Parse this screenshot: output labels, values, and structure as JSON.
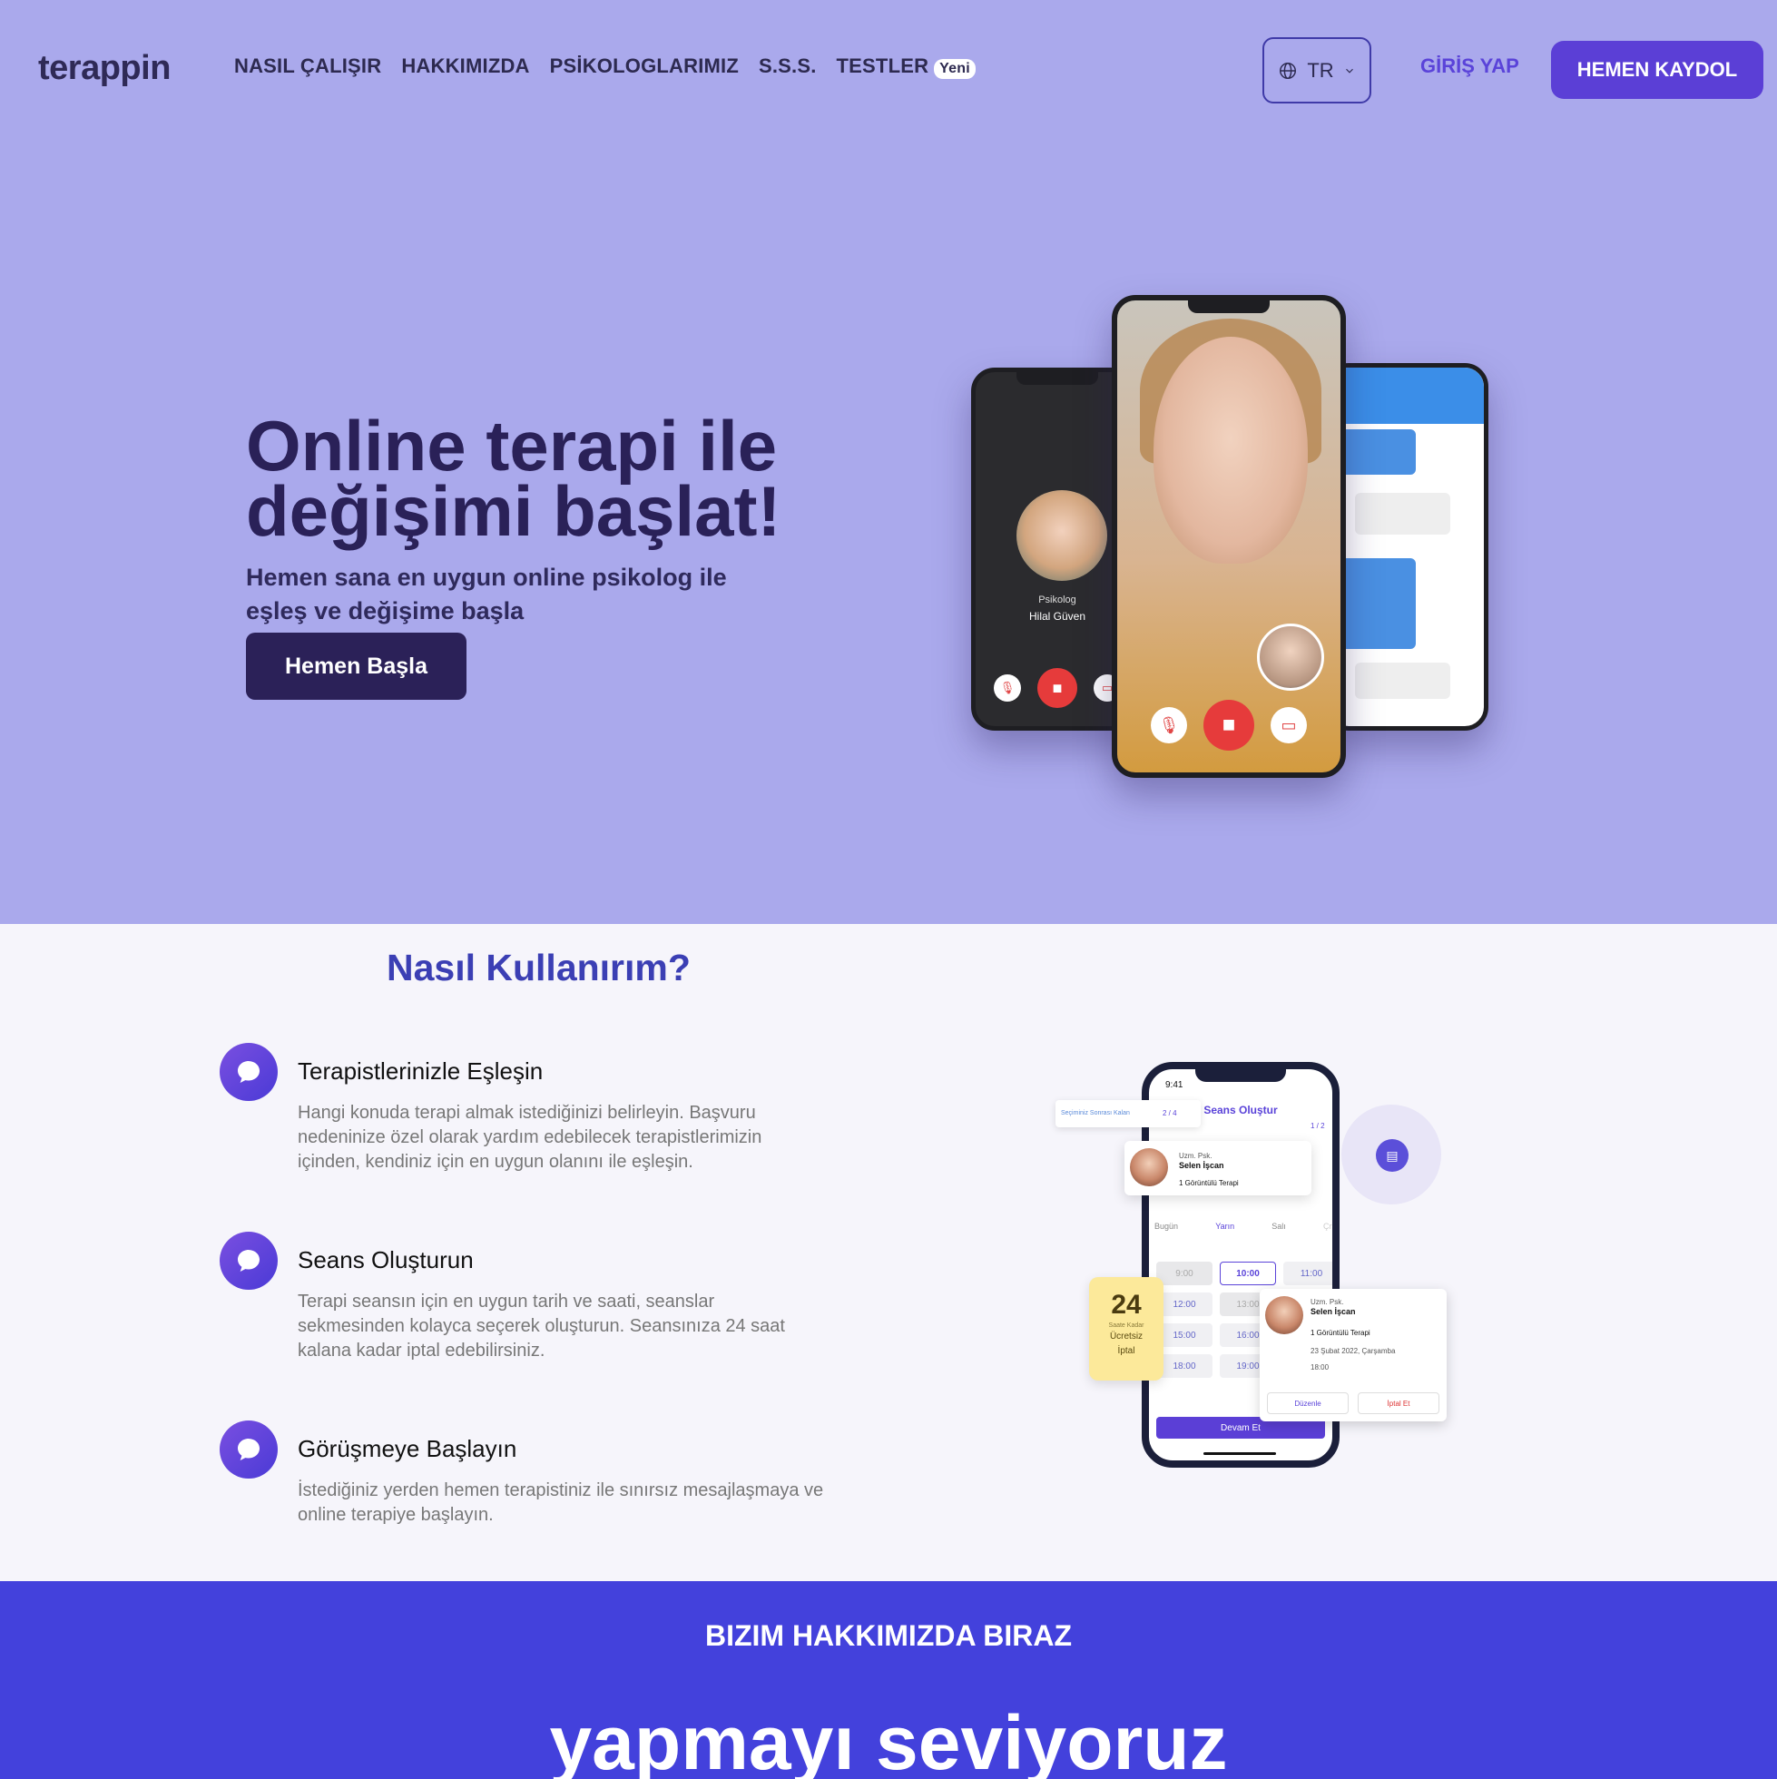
{
  "header": {
    "logo": "terappin",
    "nav": [
      "NASIL ÇALIŞIR",
      "HAKKIMIZDA",
      "PSİKOLOGLARIMIZ",
      "S.S.S.",
      "TESTLER"
    ],
    "nav_badge": "Yeni",
    "language": "TR",
    "login": "GİRİŞ YAP",
    "signup": "HEMEN KAYDOL"
  },
  "hero": {
    "title": "Online terapi ile değişimi başlat!",
    "subtitle": "Hemen sana en uygun online psikolog ile eşleş ve değişime başla",
    "cta": "Hemen Başla",
    "phone_left": {
      "role": "Psikolog",
      "name": "Hilal Güven"
    }
  },
  "how": {
    "title": "Nasıl Kullanırım?",
    "steps": [
      {
        "title": "Terapistlerinizle Eşleşin",
        "text": "Hangi konuda terapi almak istediğinizi belirleyin. Başvuru nedeninize özel olarak yardım edebilecek terapistlerimizin içinden, kendiniz için en uygun olanını ile eşleşin."
      },
      {
        "title": "Seans Oluşturun",
        "text": "Terapi seansın için en uygun tarih ve saati, seanslar sekmesinden kolayca seçerek oluşturun. Seansınıza 24 saat kalana kadar iptal edebilirsiniz."
      },
      {
        "title": "Görüşmeye Başlayın",
        "text": "İstediğiniz yerden hemen terapistiniz ile sınırsız mesajlaşmaya ve online terapiye başlayın."
      }
    ],
    "mock": {
      "time": "9:41",
      "screen_title": "Seans Oluştur",
      "remaining": "Seçiminiz Sonrası Kalan",
      "remaining_count": "2 / 4",
      "step": "1 / 2",
      "therapist_role": "Uzm. Psk.",
      "therapist_name": "Selen İşcan",
      "session_type": "1 Görüntülü Terapi",
      "days": [
        "Bugün",
        "Yarın",
        "Salı",
        "Çrş"
      ],
      "slots": [
        "9:00",
        "10:00",
        "11:00",
        "12:00",
        "13:00",
        "",
        "15:00",
        "16:00",
        "",
        "18:00",
        "19:00",
        ""
      ],
      "continue": "Devam Et",
      "card_date": "23 Şubat 2022, Çarşamba",
      "card_time": "18:00",
      "edit": "Düzenle",
      "cancel": "İptal Et",
      "badge_number": "24",
      "badge_small": "Saate Kadar",
      "badge_text1": "Ücretsiz",
      "badge_text2": "İptal"
    }
  },
  "about": {
    "kicker": "BIZIM HAKKIMIZDA BIRAZ",
    "headline": "yapmayı seviyoruz"
  }
}
